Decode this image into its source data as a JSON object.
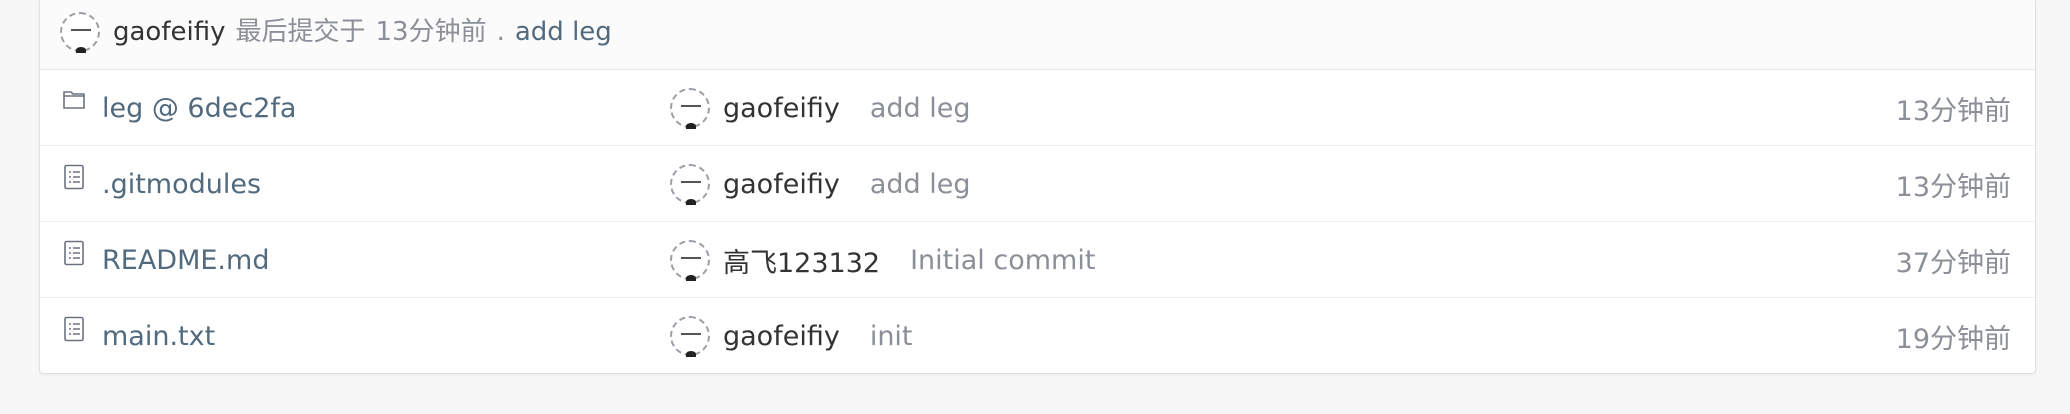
{
  "last_commit": {
    "author": "gaofeifiy",
    "label": "最后提交于",
    "time": "13分钟前",
    "separator": ".",
    "message": "add leg"
  },
  "files": [
    {
      "name": "leg @ 6dec2fa",
      "icon": "folder-icon",
      "author": "gaofeifiy",
      "message": "add leg",
      "time": "13分钟前"
    },
    {
      "name": ".gitmodules",
      "icon": "file-text-icon",
      "author": "gaofeifiy",
      "message": "add leg",
      "time": "13分钟前"
    },
    {
      "name": "README.md",
      "icon": "file-text-icon",
      "author": "高飞123132",
      "message": "Initial commit",
      "time": "37分钟前"
    },
    {
      "name": "main.txt",
      "icon": "file-text-icon",
      "author": "gaofeifiy",
      "message": "init",
      "time": "19分钟前"
    }
  ],
  "colors": {
    "link": "#526a7e",
    "muted": "#8a8f98",
    "text": "#333333"
  }
}
